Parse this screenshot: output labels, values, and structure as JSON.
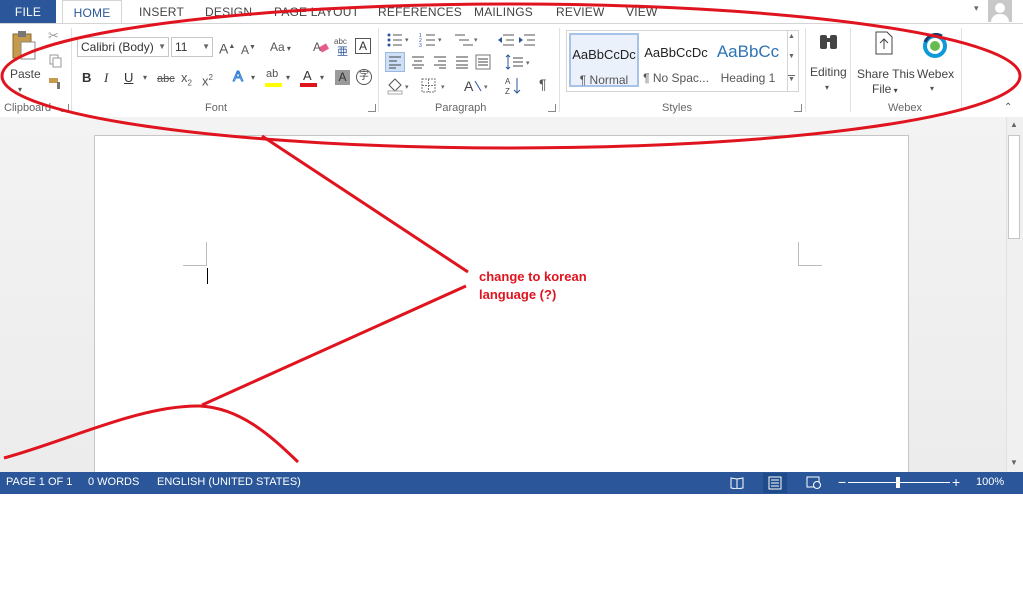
{
  "tabs": {
    "file": "FILE",
    "home": "HOME",
    "insert": "INSERT",
    "design": "DESIGN",
    "page_layout": "PAGE LAYOUT",
    "references": "REFERENCES",
    "mailings": "MAILINGS",
    "review": "REVIEW",
    "view": "VIEW"
  },
  "clipboard": {
    "paste_label": "Paste",
    "group_label": "Clipboard"
  },
  "font": {
    "font_name": "Calibri (Body)",
    "font_size": "11",
    "grow_label": "A",
    "shrink_label": "A",
    "case_label": "Aa",
    "bold": "B",
    "italic": "I",
    "underline": "U",
    "strike": "abc",
    "subscript": "x",
    "subscript_mark": "2",
    "superscript": "x",
    "superscript_mark": "2",
    "text_effects": "A",
    "highlight": "ab",
    "font_color": "A",
    "shading": "A",
    "clear_format_label": "abc",
    "char_border": "A",
    "group_label": "Font"
  },
  "paragraph": {
    "group_label": "Paragraph",
    "pilcrow": "¶"
  },
  "styles": {
    "group_label": "Styles",
    "items": [
      {
        "sample": "AaBbCcDc",
        "name": "¶ Normal"
      },
      {
        "sample": "AaBbCcDc",
        "name": "¶ No Spac..."
      },
      {
        "sample": "AaBbCc",
        "name": "Heading 1"
      }
    ]
  },
  "editing": {
    "label": "Editing"
  },
  "share": {
    "label_line1": "Share This",
    "label_line2": "File"
  },
  "webex": {
    "label": "Webex",
    "group_label": "Webex"
  },
  "status": {
    "page": "PAGE 1 OF 1",
    "words": "0 WORDS",
    "language": "ENGLISH (UNITED STATES)",
    "zoom": "100%",
    "zoom_minus": "−",
    "zoom_plus": "+"
  },
  "annotation": {
    "line1": "change to korean",
    "line2": "language (?)"
  },
  "colors": {
    "brand": "#2b579a",
    "annotation": "#e0141e",
    "highlight": "#ffff00",
    "font_color": "#e0141e"
  }
}
